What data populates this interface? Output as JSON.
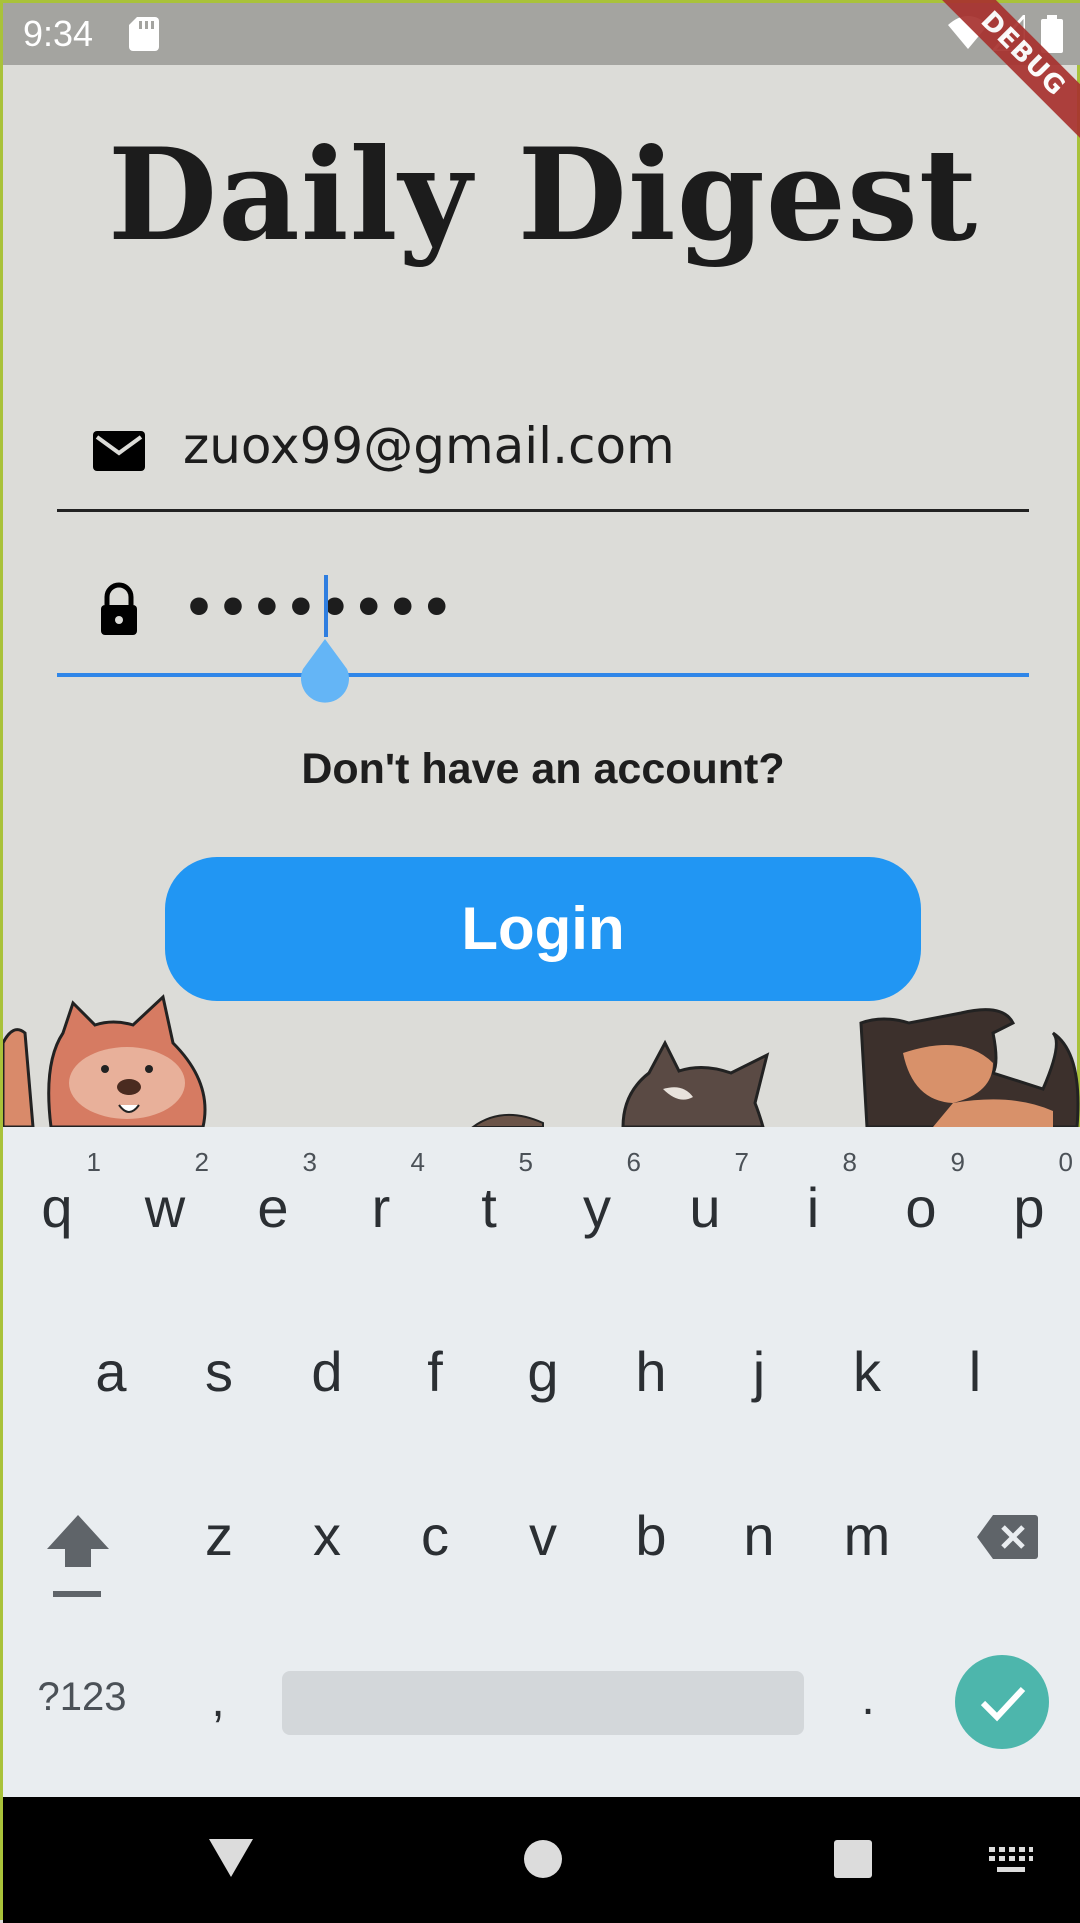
{
  "status_bar": {
    "time": "9:34",
    "icons": [
      "sd-card-icon",
      "wifi-icon",
      "signal-icon",
      "battery-icon"
    ],
    "debug_label": "DEBUG"
  },
  "app": {
    "title": "Daily Digest",
    "email": {
      "value": "zuox99@gmail.com",
      "icon": "email-icon"
    },
    "password": {
      "value": "••••••••",
      "icon": "lock-icon"
    },
    "signup_link": "Don't have an account?",
    "login_label": "Login",
    "accent_color": "#2196f3"
  },
  "keyboard": {
    "row1": [
      {
        "key": "q",
        "hint": "1"
      },
      {
        "key": "w",
        "hint": "2"
      },
      {
        "key": "e",
        "hint": "3"
      },
      {
        "key": "r",
        "hint": "4"
      },
      {
        "key": "t",
        "hint": "5"
      },
      {
        "key": "y",
        "hint": "6"
      },
      {
        "key": "u",
        "hint": "7"
      },
      {
        "key": "i",
        "hint": "8"
      },
      {
        "key": "o",
        "hint": "9"
      },
      {
        "key": "p",
        "hint": "0"
      }
    ],
    "row2": [
      "a",
      "s",
      "d",
      "f",
      "g",
      "h",
      "j",
      "k",
      "l"
    ],
    "row3": [
      "z",
      "x",
      "c",
      "v",
      "b",
      "n",
      "m"
    ],
    "symbols_label": "?123",
    "comma": ",",
    "period": ".",
    "enter_color": "#4db6ac"
  },
  "nav_bar": {
    "icons": [
      "back-icon",
      "home-icon",
      "recents-icon",
      "keyboard-icon"
    ]
  }
}
